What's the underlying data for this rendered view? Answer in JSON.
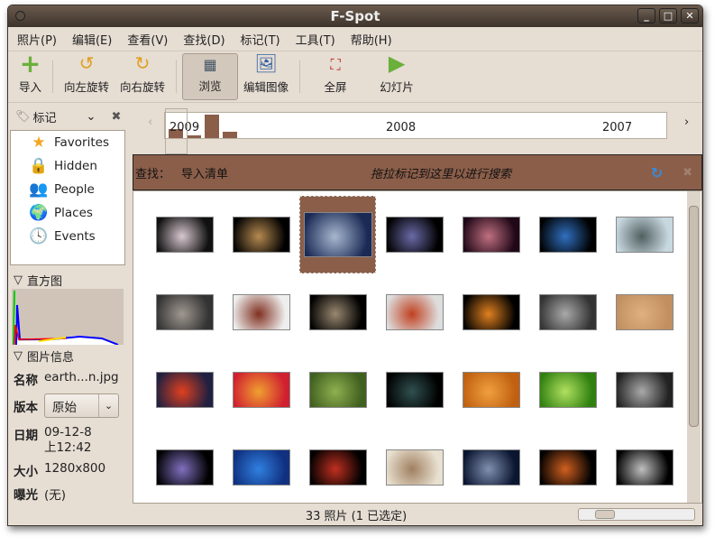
{
  "window": {
    "title": "F-Spot"
  },
  "menu": [
    "照片(P)",
    "编辑(E)",
    "查看(V)",
    "查找(D)",
    "标记(T)",
    "工具(T)",
    "帮助(H)"
  ],
  "toolbar": {
    "import": "导入",
    "rotate_left": "向左旋转",
    "rotate_right": "向右旋转",
    "browse": "浏览",
    "edit_image": "编辑图像",
    "fullscreen": "全屏",
    "slideshow": "幻灯片"
  },
  "tags": {
    "selector": "标记",
    "items": [
      "Favorites",
      "Hidden",
      "People",
      "Places",
      "Events"
    ]
  },
  "histogram": {
    "title": "直方图"
  },
  "info": {
    "title": "图片信息",
    "name_label": "名称",
    "name": "earth...n.jpg",
    "version_label": "版本",
    "version": "原始",
    "date_label": "日期",
    "date": "09-12-8",
    "time": "上12:42",
    "size_label": "大小",
    "size": "1280x800",
    "exposure_label": "曝光",
    "exposure": "(无)"
  },
  "timeline": {
    "years": [
      "2009",
      "2008",
      "2007"
    ],
    "counts": [
      3,
      1,
      8,
      2
    ]
  },
  "find": {
    "label": "查找：",
    "query": "导入清单",
    "hint": "拖拉标记到这里以进行搜索"
  },
  "photos": {
    "selected_index": 2,
    "colors": [
      [
        "#111",
        "#d8c8d0"
      ],
      [
        "#000",
        "#b58a50"
      ],
      [
        "#1a2a55",
        "#a8b8d0"
      ],
      [
        "#000",
        "#6a6aa8"
      ],
      [
        "#200818",
        "#c07080"
      ],
      [
        "#000",
        "#3070c0"
      ],
      [
        "#c8d8e0",
        "#506060"
      ],
      [
        "#333",
        "#a09890"
      ],
      [
        "#eee",
        "#803020"
      ],
      [
        "#000",
        "#998870"
      ],
      [
        "#ddd",
        "#c04020"
      ],
      [
        "#000",
        "#e08020"
      ],
      [
        "#333",
        "#aaa"
      ],
      [
        "#c09060",
        "#e0b080"
      ],
      [
        "#202040",
        "#e04020"
      ],
      [
        "#d02030",
        "#f0a030"
      ],
      [
        "#406020",
        "#90b050"
      ],
      [
        "#000",
        "#305050"
      ],
      [
        "#c06010",
        "#f0a040"
      ],
      [
        "#308010",
        "#b0e060"
      ],
      [
        "#222",
        "#aaa"
      ],
      [
        "#000",
        "#8070c0"
      ],
      [
        "#103080",
        "#3080e0"
      ],
      [
        "#000",
        "#c03020"
      ],
      [
        "#e8e0d0",
        "#a08060"
      ],
      [
        "#0a1530",
        "#8090b0"
      ],
      [
        "#000",
        "#d06020"
      ],
      [
        "#000",
        "#c0c0c0"
      ]
    ]
  },
  "status": {
    "text": "33 照片 (1 已选定)"
  }
}
